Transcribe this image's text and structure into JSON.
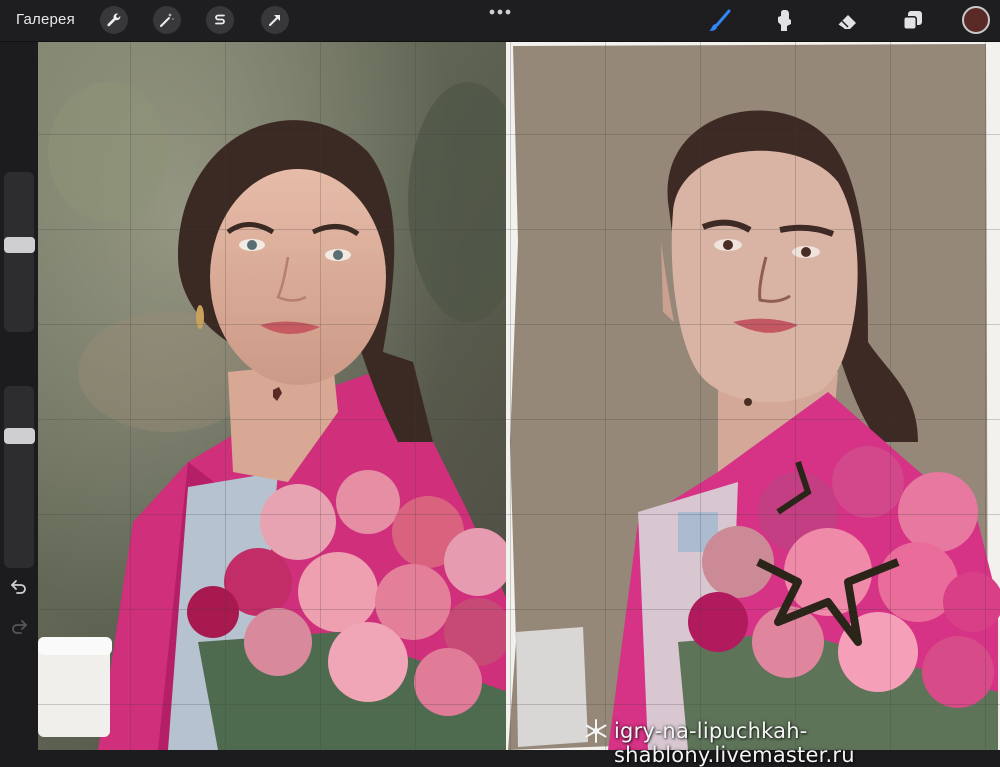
{
  "topbar": {
    "gallery_label": "Галерея",
    "left_tools": [
      "wrench-icon",
      "magic-wand-icon",
      "selection-s-icon",
      "transform-arrow-icon"
    ],
    "right_tools": [
      "brush-icon",
      "smudge-icon",
      "eraser-icon",
      "layers-icon"
    ],
    "active_tool": "brush-icon",
    "accent_color": "#2f86f6",
    "current_color": "#5a2b26"
  },
  "sidebar": {
    "brush_size_level": 0.55,
    "opacity_level": 0.7,
    "icons": [
      "modify-square-icon",
      "undo-icon",
      "redo-icon"
    ]
  },
  "canvas": {
    "watermark": "igry-na-lipuchkah-shablony.livemaster.ru",
    "left_panel": "reference-photo",
    "right_panel": "digital-painting",
    "grid": "on"
  }
}
